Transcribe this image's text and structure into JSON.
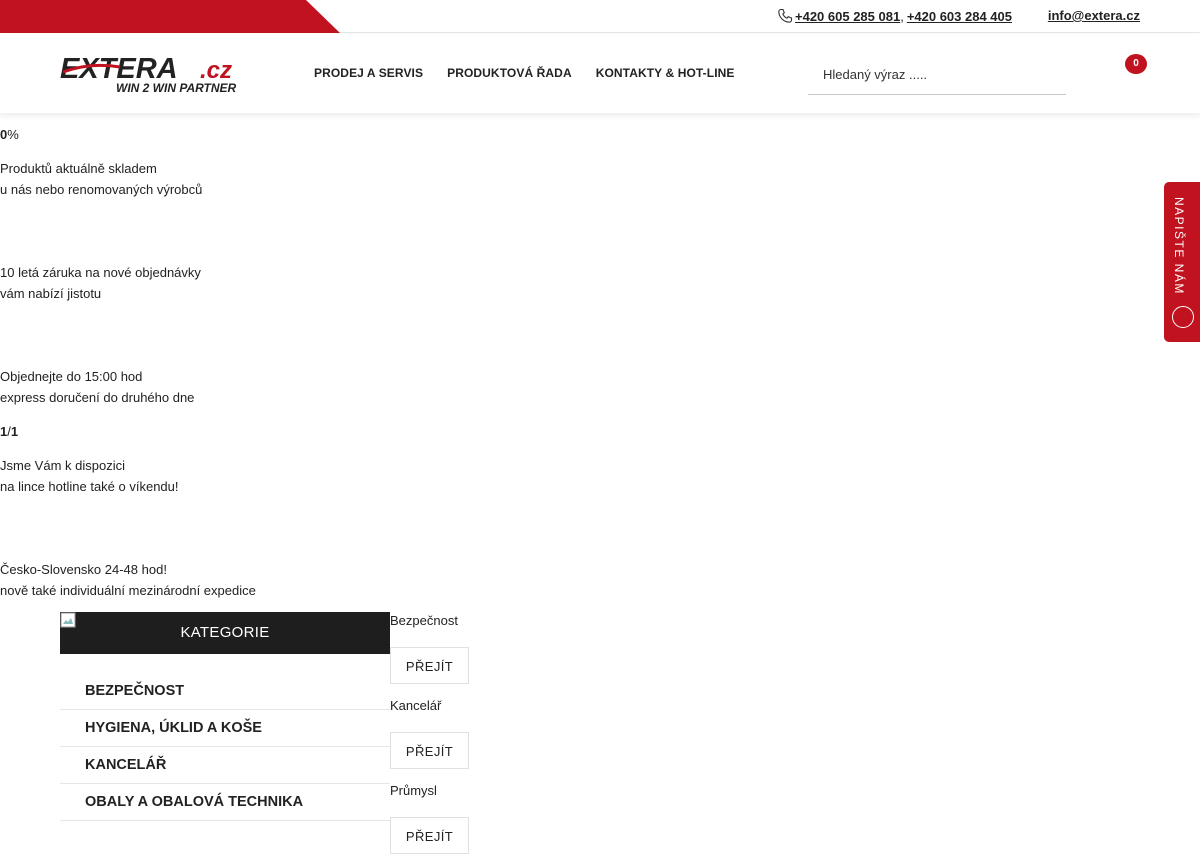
{
  "topbar": {
    "phone1": "+420 605 285 081",
    "separator": ",",
    "phone2": "+420 603 284 405",
    "email": "info@extera.cz"
  },
  "logo": {
    "brand": "EXTERA",
    "tld": ".cz",
    "tagline": "WIN 2 WIN PARTNER"
  },
  "nav": {
    "items": [
      "PRODEJ A SERVIS",
      "PRODUKTOVÁ ŘADA",
      "KONTAKTY & HOT-LINE"
    ]
  },
  "search": {
    "placeholder": "Hledaný výraz ....."
  },
  "cart": {
    "count": "0"
  },
  "info": {
    "stat1_value": "0",
    "stat1_unit": "%",
    "line1a": "Produktů aktuálně skladem",
    "line1b": "u nás nebo renomovaných výrobců",
    "line2a": "10 letá záruka na nové objednávky",
    "line2b": "vám nabízí jistotu",
    "line3a": "Objednejte do 15:00 hod",
    "line3b": "express doručení do druhého dne",
    "stat2_a": "1",
    "stat2_sep": "/",
    "stat2_b": "1",
    "line4a": "Jsme Vám k dispozici",
    "line4b": "na lince hotline také o víkendu!",
    "line5a": "Česko-Slovensko 24-48 hod!",
    "line5b": "nově také individuální mezinárodní expedice"
  },
  "sidetab": {
    "label": "NAPIŠTE NÁM"
  },
  "categories": {
    "title": "KATEGORIE",
    "items": [
      "BEZPEČNOST",
      "HYGIENA, ÚKLID A KOŠE",
      "KANCELÁŘ",
      "OBALY A OBALOVÁ TECHNIKA"
    ]
  },
  "blocks": [
    {
      "name": "Bezpečnost",
      "button": "PŘEJÍT"
    },
    {
      "name": "Kancelář",
      "button": "PŘEJÍT"
    },
    {
      "name": "Průmysl",
      "button": "PŘEJÍT"
    }
  ],
  "colors": {
    "accent": "#c1121f",
    "dark": "#1e1e1e"
  }
}
